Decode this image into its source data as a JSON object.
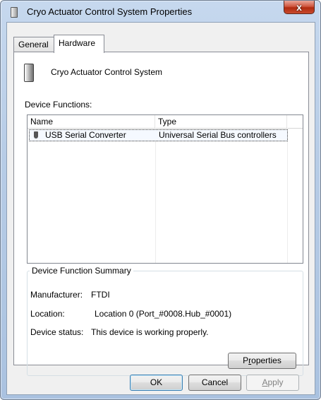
{
  "window": {
    "title": "Cryo Actuator Control System Properties",
    "close_label": "x"
  },
  "tabs": [
    {
      "label": "General",
      "selected": false
    },
    {
      "label": "Hardware",
      "selected": true
    }
  ],
  "hardware": {
    "device_name": "Cryo Actuator Control System",
    "device_functions_label": "Device Functions:",
    "columns": [
      "Name",
      "Type"
    ],
    "rows": [
      {
        "name": "USB Serial Converter",
        "type": "Universal Serial Bus controllers",
        "icon": "usb-icon"
      }
    ],
    "summary": {
      "title": "Device Function Summary",
      "manufacturer_label": "Manufacturer:",
      "manufacturer_value": "FTDI",
      "location_label": "Location:",
      "location_value": "Location 0 (Port_#0008.Hub_#0001)",
      "status_label": "Device status:",
      "status_value": "This device is working properly."
    },
    "properties_button": {
      "pre": "P",
      "accel": "r",
      "post": "operties"
    }
  },
  "buttons": {
    "ok": "OK",
    "cancel": "Cancel",
    "apply": {
      "accel": "A",
      "post": "pply"
    }
  }
}
